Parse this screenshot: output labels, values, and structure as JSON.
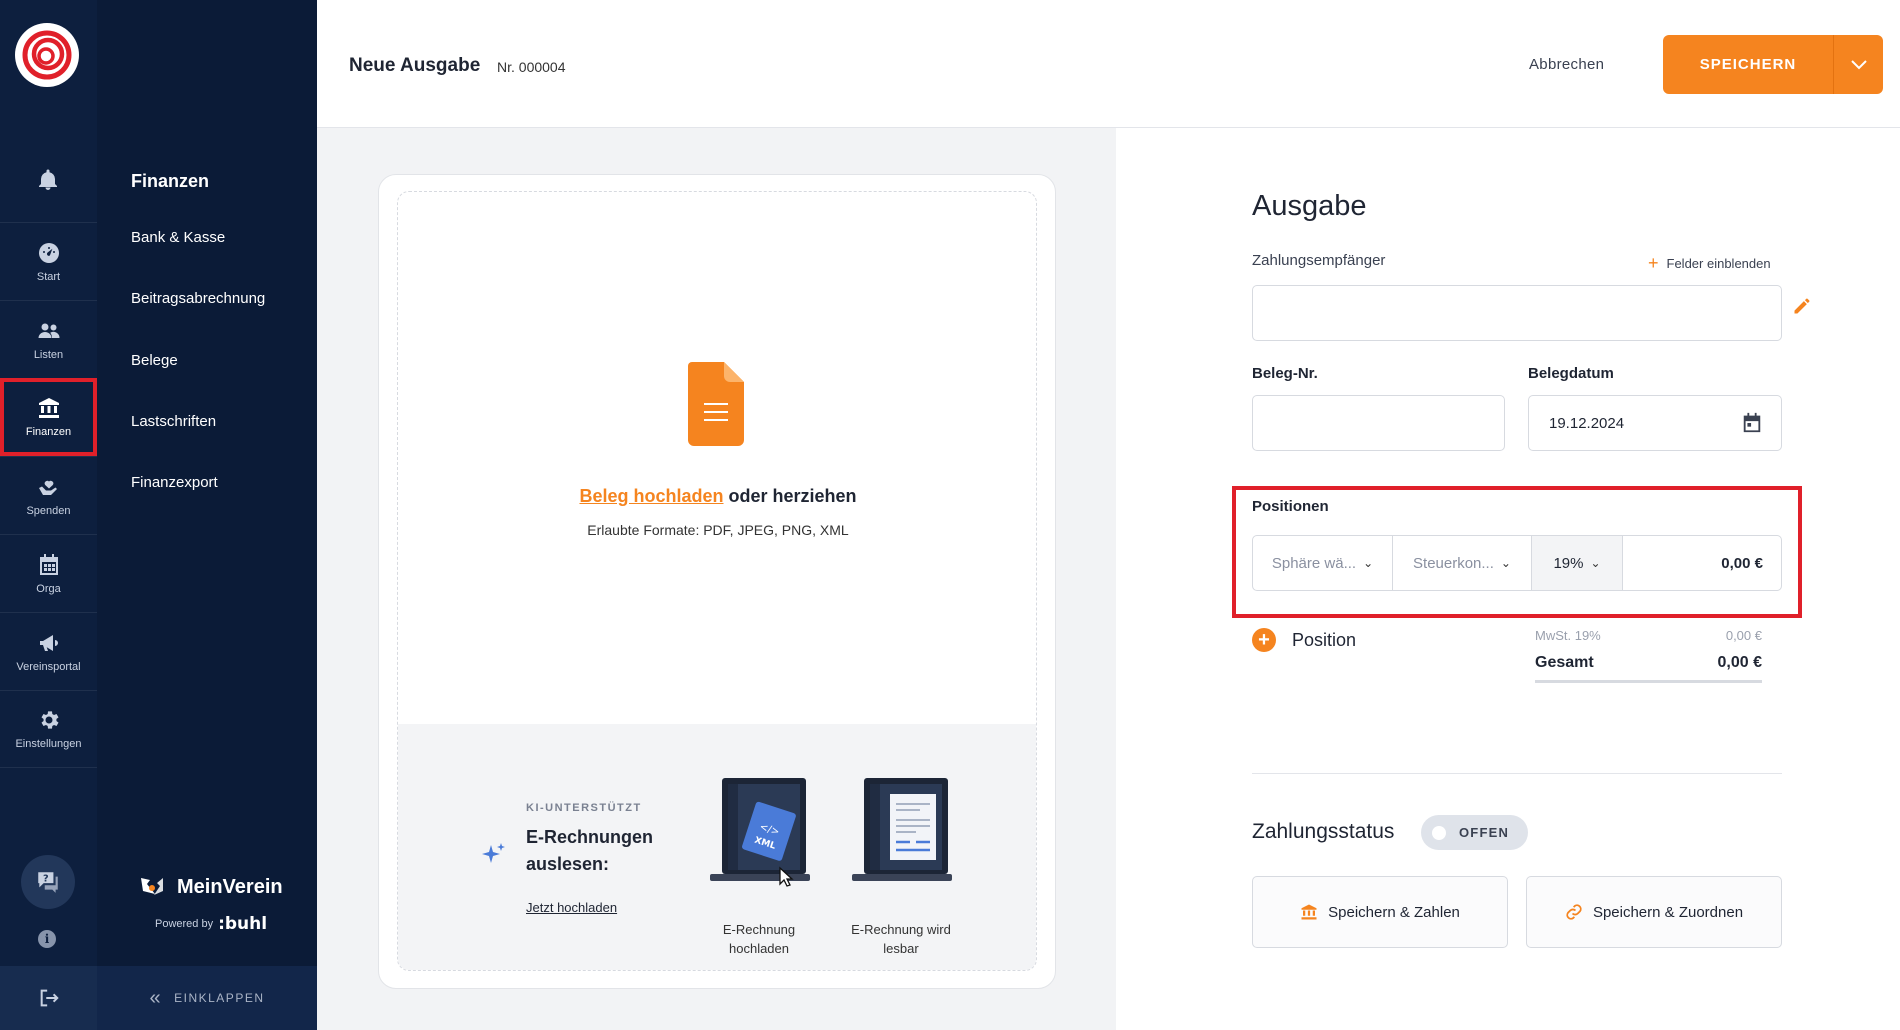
{
  "rail": {
    "items": [
      {
        "label": "Start"
      },
      {
        "label": "Listen"
      },
      {
        "label": "Finanzen"
      },
      {
        "label": "Spenden"
      },
      {
        "label": "Orga"
      },
      {
        "label": "Vereinsportal"
      },
      {
        "label": "Einstellungen"
      }
    ]
  },
  "subnav": {
    "title": "Finanzen",
    "items": [
      "Bank & Kasse",
      "Beitragsabrechnung",
      "Belege",
      "Lastschriften",
      "Finanzexport"
    ],
    "brand": "MeinVerein",
    "powered_by": "Powered by",
    "powered_brand": ":buhl",
    "collapse": "EINKLAPPEN"
  },
  "header": {
    "title": "Neue Ausgabe",
    "number": "Nr. 000004",
    "cancel": "Abbrechen",
    "save": "SPEICHERN"
  },
  "upload": {
    "link": "Beleg hochladen",
    "rest": " oder herziehen",
    "formats": "Erlaubte Formate: PDF, JPEG, PNG, XML",
    "ki_kicker": "KI-UNTERSTÜTZT",
    "ki_title": "E-Rechnungen auslesen:",
    "ki_link": "Jetzt hochladen",
    "step1": "E-Rechnung hochladen",
    "step2": "E-Rechnung wird lesbar",
    "xml_tag": "XML"
  },
  "form": {
    "title": "Ausgabe",
    "payee_label": "Zahlungsempfänger",
    "show_fields": "Felder einblenden",
    "payee_value": "",
    "beleg_nr_label": "Beleg-Nr.",
    "beleg_nr_value": "",
    "date_label": "Belegdatum",
    "date_value": "19.12.2024",
    "positions_label": "Positionen",
    "sphere": "Sphäre wä...",
    "tax_account": "Steuerkon...",
    "vat": "19%",
    "amount": "0,00 €",
    "add_position": "Position",
    "mwst_label": "MwSt. 19%",
    "mwst_value": "0,00 €",
    "total_label": "Gesamt",
    "total_value": "0,00 €",
    "payment_status_title": "Zahlungsstatus",
    "status": "OFFEN",
    "save_pay": "Speichern & Zahlen",
    "save_assign": "Speichern & Zuordnen"
  },
  "colors": {
    "accent": "#f5841f",
    "rail_bg": "#0d1f3e",
    "highlight": "#e0202a"
  }
}
